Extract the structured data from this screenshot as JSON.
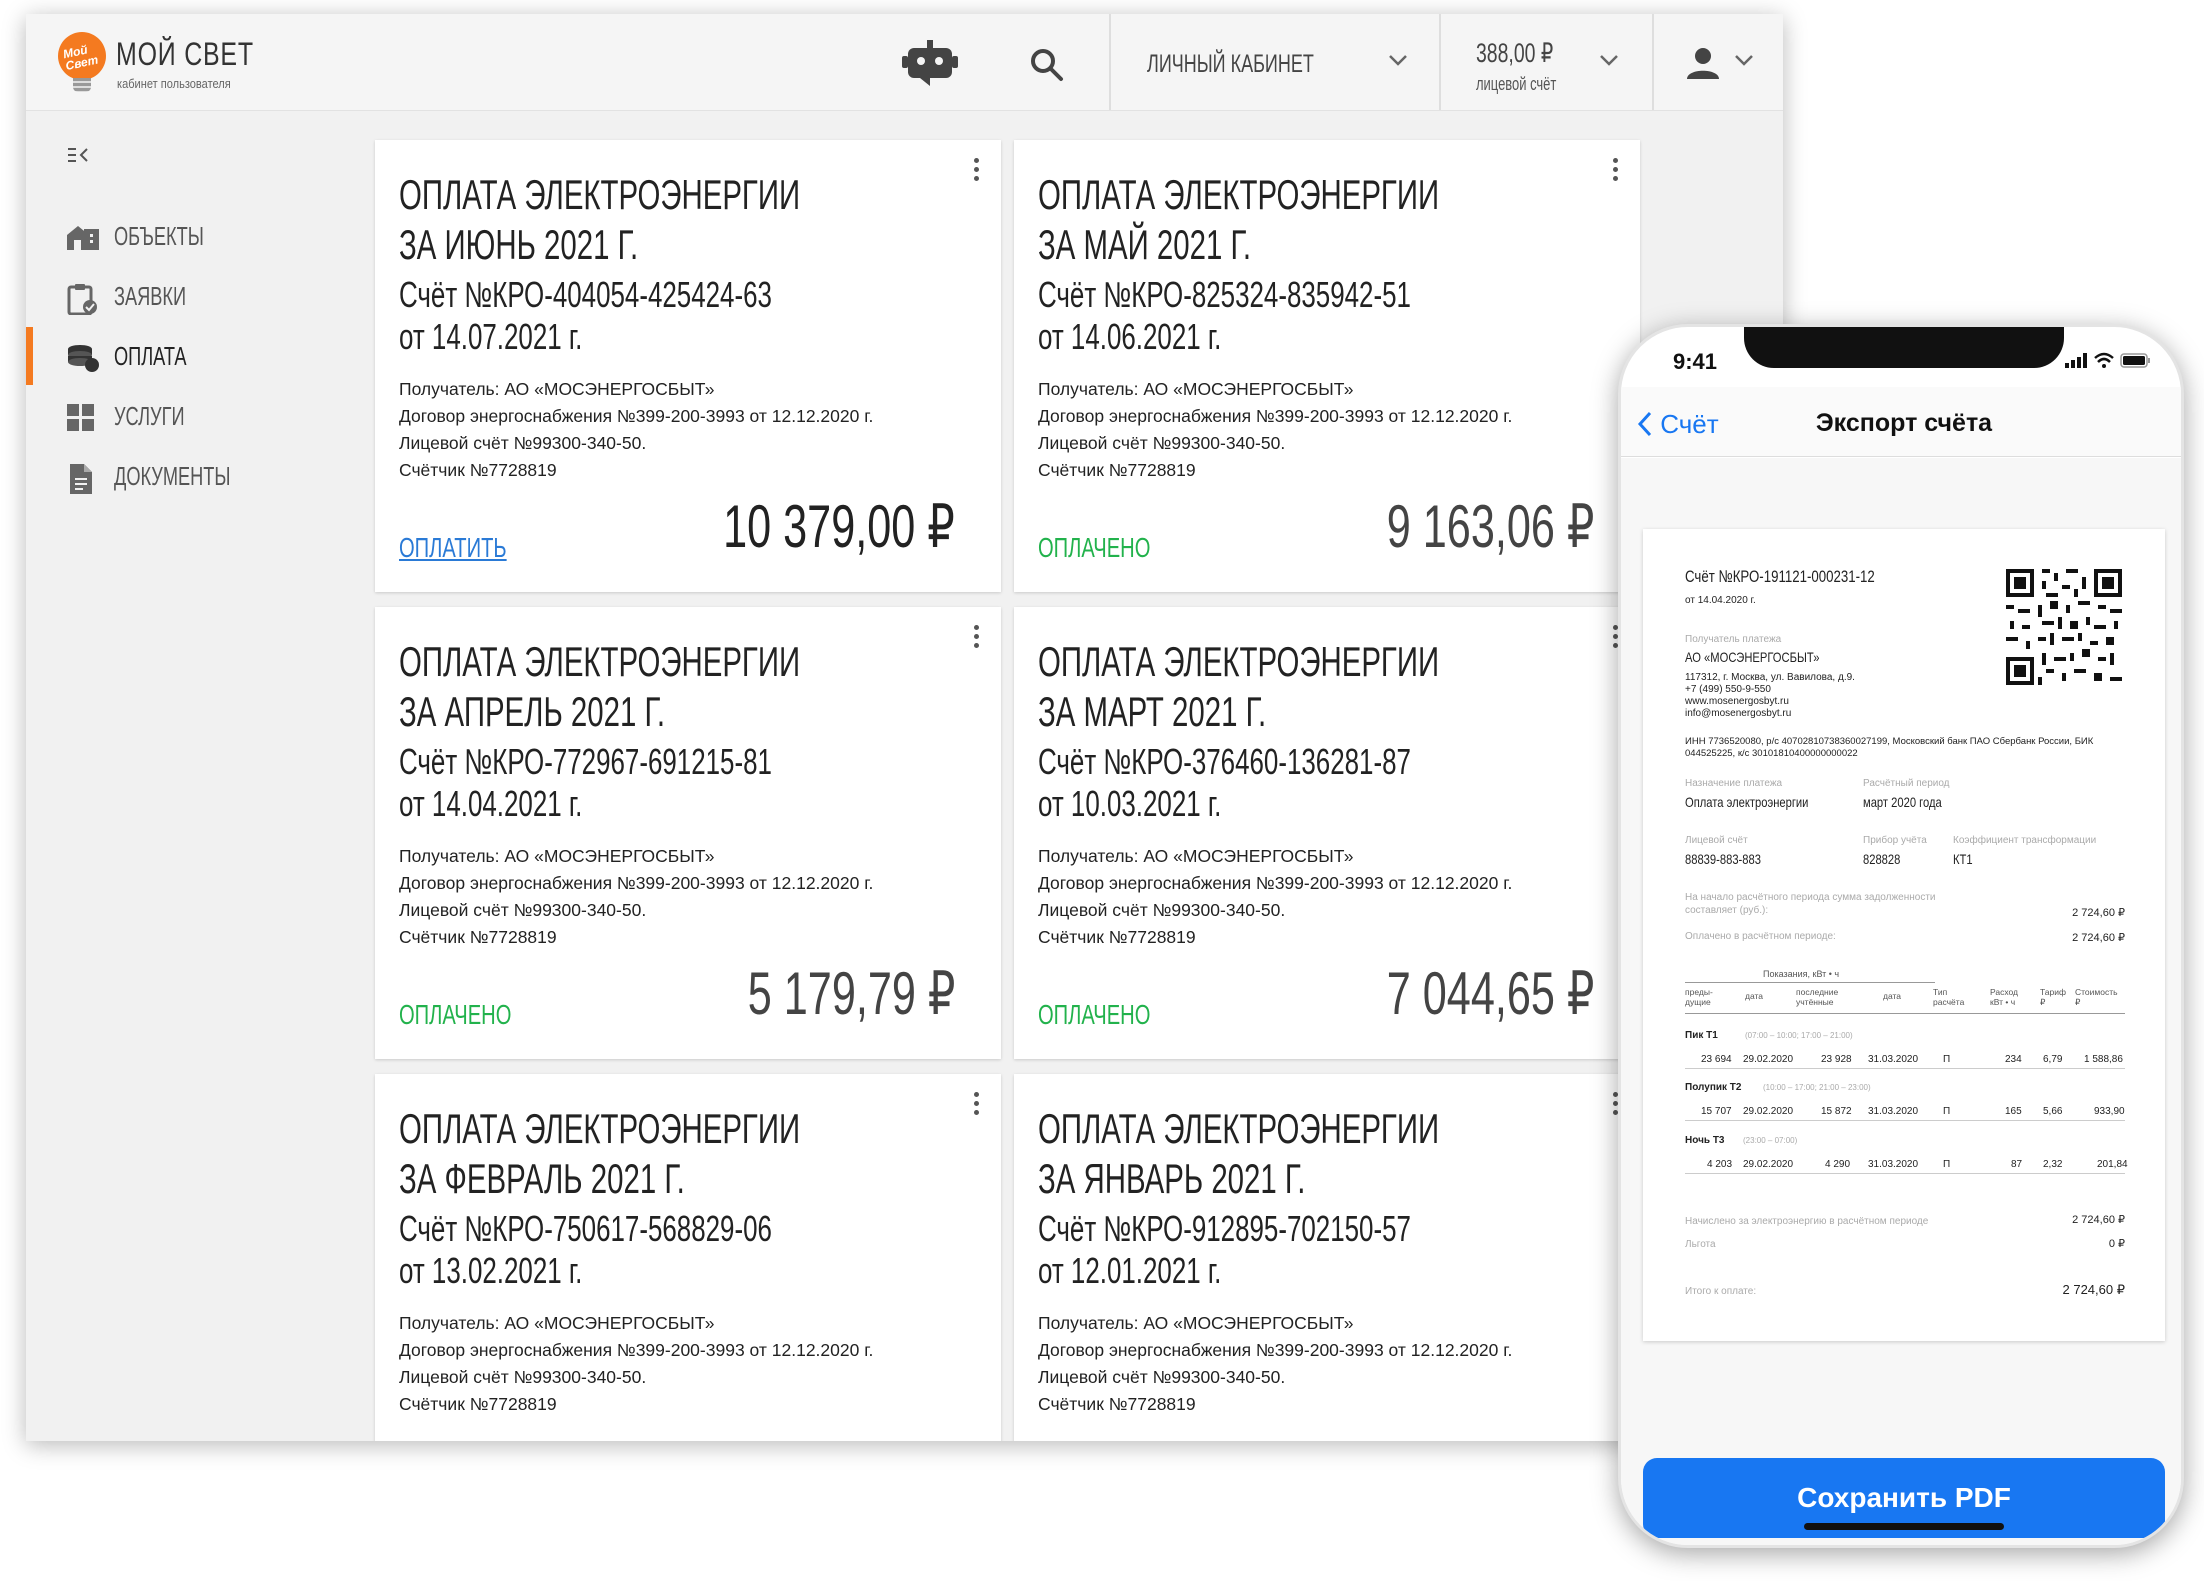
{
  "app": {
    "title": "МОЙ СВЕТ",
    "subtitle": "кабинет пользователя",
    "logo_text": "Мой Свет"
  },
  "header": {
    "cabinet_label": "ЛИЧНЫЙ КАБИНЕТ",
    "balance": "388,00 ₽",
    "balance_caption": "лицевой счёт",
    "icons": [
      "robot-icon",
      "search-icon",
      "user-icon"
    ]
  },
  "sidebar": {
    "items": [
      {
        "label": "ОБЪЕКТЫ",
        "icon": "building-icon"
      },
      {
        "label": "ЗАЯВКИ",
        "icon": "clipboard-icon"
      },
      {
        "label": "ОПЛАТА",
        "icon": "coins-icon",
        "active": true
      },
      {
        "label": "УСЛУГИ",
        "icon": "grid-icon"
      },
      {
        "label": "ДОКУМЕНТЫ",
        "icon": "document-icon"
      }
    ]
  },
  "cards": [
    {
      "title1": "ОПЛАТА ЭЛЕКТРОЭНЕРГИИ",
      "title2": "ЗА ИЮНЬ 2021 Г.",
      "number": "Счёт №КРО-404054-425424-63",
      "date": "от 14.07.2021 г.",
      "recipient": "Получатель: АО «МОСЭНЕРГОСБЫТ»",
      "contract": "Договор энергоснабжения №399-200-3993 от 12.12.2020 г.",
      "account": "Лицевой счёт №99300-340-50.",
      "meter": "Счётчик №7728819",
      "status": "ОПЛАТИТЬ",
      "status_type": "pay",
      "amount": "10 379,00 ₽"
    },
    {
      "title1": "ОПЛАТА ЭЛЕКТРОЭНЕРГИИ",
      "title2": "ЗА МАЙ 2021 Г.",
      "number": "Счёт №КРО-825324-835942-51",
      "date": "от 14.06.2021 г.",
      "recipient": "Получатель: АО «МОСЭНЕРГОСБЫТ»",
      "contract": "Договор энергоснабжения №399-200-3993 от 12.12.2020 г.",
      "account": "Лицевой счёт №99300-340-50.",
      "meter": "Счётчик №7728819",
      "status": "ОПЛАЧЕНО",
      "status_type": "paid",
      "amount": "9 163,06 ₽"
    },
    {
      "title1": "ОПЛАТА ЭЛЕКТРОЭНЕРГИИ",
      "title2": "ЗА АПРЕЛЬ 2021 Г.",
      "number": "Счёт №КРО-772967-691215-81",
      "date": "от 14.04.2021 г.",
      "recipient": "Получатель: АО «МОСЭНЕРГОСБЫТ»",
      "contract": "Договор энергоснабжения №399-200-3993 от 12.12.2020 г.",
      "account": "Лицевой счёт №99300-340-50.",
      "meter": "Счётчик №7728819",
      "status": "ОПЛАЧЕНО",
      "status_type": "paid",
      "amount": "5 179,79 ₽"
    },
    {
      "title1": "ОПЛАТА ЭЛЕКТРОЭНЕРГИИ",
      "title2": "ЗА МАРТ 2021 Г.",
      "number": "Счёт №КРО-376460-136281-87",
      "date": "от 10.03.2021 г.",
      "recipient": "Получатель: АО «МОСЭНЕРГОСБЫТ»",
      "contract": "Договор энергоснабжения №399-200-3993 от 12.12.2020 г.",
      "account": "Лицевой счёт №99300-340-50.",
      "meter": "Счётчик №7728819",
      "status": "ОПЛАЧЕНО",
      "status_type": "paid",
      "amount": "7 044,65 ₽"
    },
    {
      "title1": "ОПЛАТА ЭЛЕКТРОЭНЕРГИИ",
      "title2": "ЗА ФЕВРАЛЬ 2021 Г.",
      "number": "Счёт №КРО-750617-568829-06",
      "date": "от 13.02.2021 г.",
      "recipient": "Получатель: АО «МОСЭНЕРГОСБЫТ»",
      "contract": "Договор энергоснабжения №399-200-3993 от 12.12.2020 г.",
      "account": "Лицевой счёт №99300-340-50.",
      "meter": "Счётчик №7728819",
      "status": "",
      "status_type": "paid",
      "amount": ""
    },
    {
      "title1": "ОПЛАТА ЭЛЕКТРОЭНЕРГИИ",
      "title2": "ЗА ЯНВАРЬ 2021 Г.",
      "number": "Счёт №КРО-912895-702150-57",
      "date": "от 12.01.2021 г.",
      "recipient": "Получатель: АО «МОСЭНЕРГОСБЫТ»",
      "contract": "Договор энергоснабжения №399-200-3993 от 12.12.2020 г.",
      "account": "Лицевой счёт №99300-340-50.",
      "meter": "Счётчик №7728819",
      "status": "",
      "status_type": "paid",
      "amount": ""
    }
  ],
  "phone": {
    "time": "9:41",
    "back_label": "Счёт",
    "title": "Экспорт счёта",
    "save_button": "Сохранить PDF",
    "invoice": {
      "number": "Счёт №КРО-191121-000231-12",
      "date": "от 14.04.2020 г.",
      "payee_caption": "Получатель платежа",
      "payee": "АО «МОСЭНЕРГОСБЫТ»",
      "address": "117312, г. Москва, ул. Вавилова, д.9.",
      "phone": "+7 (499) 550-9-550",
      "site": "www.mosenergosbyt.ru",
      "email": "info@mosenergosbyt.ru",
      "bank1": "ИНН 7736520080, р/с 40702810738360027199, Московский банк ПАО Сбербанк России, БИК",
      "bank2": "044525225, к/с 30101810400000000022",
      "purpose_caption": "Назначение платежа",
      "purpose": "Оплата электроэнергии",
      "period_caption": "Расчётный период",
      "period": "март 2020 года",
      "account_caption": "Лицевой счёт",
      "account": "88839-883-883",
      "device_caption": "Прибор учёта",
      "device": "828828",
      "coef_caption": "Коэффициент трансформации",
      "coef": "КТ1",
      "debt_caption1": "На начало расчётного периода сумма задолженности",
      "debt_caption2": "составляет (руб.):",
      "debt": "2 724,60 ₽",
      "paid_caption": "Оплачено в расчётном периоде:",
      "paid": "2 724,60 ₽",
      "table_group": "Показания, кВт • ч",
      "col_prev": "преды-",
      "col_prev2": "дущие",
      "col_date": "дата",
      "col_last": "последние",
      "col_last2": "учтённые",
      "col_date2": "дата",
      "col_type": "Тип",
      "col_type2": "расчёта",
      "col_usage": "Расход",
      "col_usage2": "кВт • ч",
      "col_tariff": "Тариф",
      "col_tariff2": "₽",
      "col_cost": "Стоимость",
      "col_cost2": "₽",
      "zones": [
        {
          "name": "Пик Т1",
          "hours": "(07:00 – 10:00; 17:00 – 21:00)",
          "prev": "23 694",
          "prev_date": "29.02.2020",
          "last": "23 928",
          "last_date": "31.03.2020",
          "type": "П",
          "usage": "234",
          "tariff": "6,79",
          "cost": "1 588,86"
        },
        {
          "name": "Полупик Т2",
          "hours": "(10:00 – 17:00; 21:00 – 23:00)",
          "prev": "15 707",
          "prev_date": "29.02.2020",
          "last": "15 872",
          "last_date": "31.03.2020",
          "type": "П",
          "usage": "165",
          "tariff": "5,66",
          "cost": "933,90"
        },
        {
          "name": "Ночь Т3",
          "hours": "(23:00 – 07:00)",
          "prev": "4 203",
          "prev_date": "29.02.2020",
          "last": "4 290",
          "last_date": "31.03.2020",
          "type": "П",
          "usage": "87",
          "tariff": "2,32",
          "cost": "201,84"
        }
      ],
      "accrued_caption": "Начислено за электроэнергию в расчётном периоде",
      "accrued": "2 724,60 ₽",
      "benefit_caption": "Льгота",
      "benefit": "0 ₽",
      "total_caption": "Итого к оплате:",
      "total": "2 724,60 ₽"
    }
  },
  "colors": {
    "accent": "#f47a20",
    "paid": "#22b24c",
    "link": "#2a7ad6",
    "ios_blue": "#1877f2"
  }
}
